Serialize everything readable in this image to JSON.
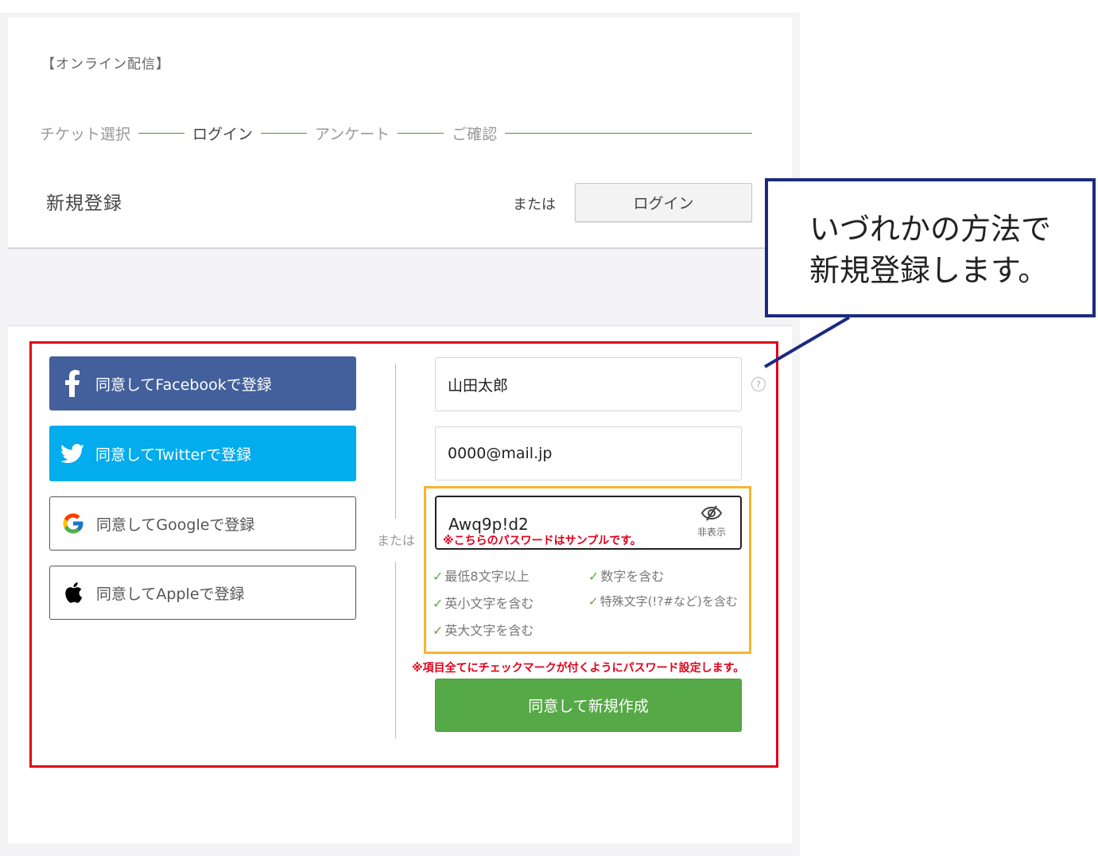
{
  "header": {
    "event_title": "【オンライン配信】",
    "steps": [
      "チケット選択",
      "ログイン",
      "アンケート",
      "ご確認"
    ]
  },
  "register": {
    "title": "新規登録",
    "or_label": "または",
    "login_button": "ログイン"
  },
  "social": {
    "facebook": "同意してFacebookで登録",
    "twitter": "同意してTwitterで登録",
    "google": "同意してGoogleで登録",
    "apple": "同意してAppleで登録",
    "or_label": "または"
  },
  "form": {
    "name_value": "山田太郎",
    "email_value": "0000@mail.jp",
    "password_value": "Awq9p!d2",
    "password_note": "※こちらのパスワードはサンプルです。",
    "toggle_label": "非表示",
    "requirements": [
      "最低8文字以上",
      "数字を含む",
      "英小文字を含む",
      "特殊文字(!?#など)を含む",
      "英大文字を含む"
    ],
    "rule_note": "※項目全てにチェックマークが付くようにパスワード設定します。",
    "submit_label": "同意して新規作成"
  },
  "callout": {
    "line1": "いづれかの方法で",
    "line2": "新規登録します。"
  },
  "colors": {
    "facebook": "#43609c",
    "twitter": "#02aced",
    "submit": "#56a947",
    "highlight_red": "#e0001b",
    "highlight_orange": "#f5b52e",
    "callout_border": "#1b2a80"
  }
}
